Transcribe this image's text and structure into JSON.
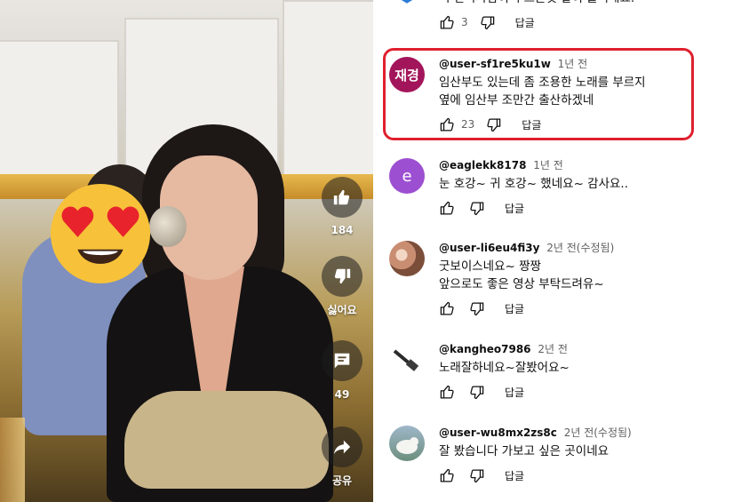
{
  "video": {
    "like_count": "184",
    "dislike_label": "싫어요",
    "comment_count": "49",
    "share_label": "공유"
  },
  "top_partial_comment": {
    "text": "식 한국사람이 부르는것 같이 들리네요.",
    "likes": "3",
    "reply_label": "답글"
  },
  "comments": [
    {
      "author": "@user-sf1re5ku1w",
      "time": "1년 전",
      "avatar_text": "재경",
      "avatar_color": "#a3155a",
      "lines": [
        "임산부도 있는데 좀 조용한 노래를 부르지",
        "옆에 임산부 조만간 출산하겠네"
      ],
      "likes": "23",
      "reply_label": "답글",
      "highlighted": true
    },
    {
      "author": "@eaglekk8178",
      "time": "1년 전",
      "avatar_text": "e",
      "avatar_color": "#9d4fd1",
      "lines": [
        "눈 호강~ 귀 호강~ 했네요~ 감사요.."
      ],
      "likes": "",
      "reply_label": "답글"
    },
    {
      "author": "@user-li6eu4fi3y",
      "time": "2년 전(수정됨)",
      "avatar_text": "",
      "avatar_color": "#c98e72",
      "lines": [
        "굿보이스네요~ 짱짱",
        "앞으로도 좋은 영상 부탁드려유~"
      ],
      "likes": "",
      "reply_label": "답글"
    },
    {
      "author": "@kangheo7986",
      "time": "2년 전",
      "avatar_text": "",
      "avatar_color": "#ffffff",
      "lines": [
        "노래잘하네요~잘봤어요~"
      ],
      "likes": "",
      "reply_label": "답글"
    },
    {
      "author": "@user-wu8mx2zs8c",
      "time": "2년 전(수정됨)",
      "avatar_text": "",
      "avatar_color": "#6c8f7e",
      "lines": [
        "잘 봤습니다 가보고 싶은 곳이네요"
      ],
      "likes": "",
      "reply_label": "답글"
    }
  ],
  "colors": {
    "highlight_border": "#e0202e",
    "meta_text": "#606060"
  }
}
